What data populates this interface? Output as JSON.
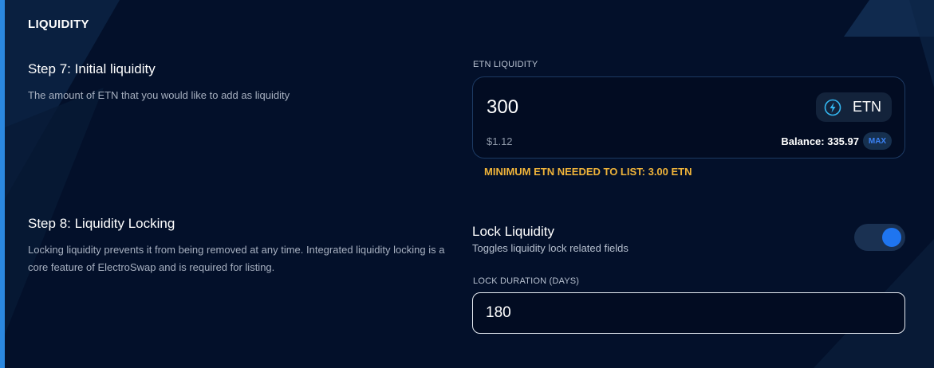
{
  "section": {
    "title": "LIQUIDITY"
  },
  "step7": {
    "title": "Step 7: Initial liquidity",
    "description": "The amount of ETN that you would like to add as liquidity"
  },
  "etn_liquidity": {
    "label": "ETN LIQUIDITY",
    "amount": "300",
    "token_icon": "lightning-bolt-icon",
    "token": "ETN",
    "usd_value": "$1.12",
    "balance": "Balance: 335.97",
    "max_label": "MAX",
    "warning": "MINIMUM ETN NEEDED TO LIST: 3.00 ETN"
  },
  "step8": {
    "title": "Step 8: Liquidity Locking",
    "description": "Locking liquidity prevents it from being removed at any time. Integrated liquidity locking is a core feature of ElectroSwap and is required for listing."
  },
  "lock": {
    "title": "Lock Liquidity",
    "subtitle": "Toggles liquidity lock related fields",
    "enabled": true,
    "duration_label": "LOCK DURATION (DAYS)",
    "duration_value": "180"
  },
  "colors": {
    "background": "#03102a",
    "accent": "#1f75f0",
    "warning": "#f0b43a"
  }
}
